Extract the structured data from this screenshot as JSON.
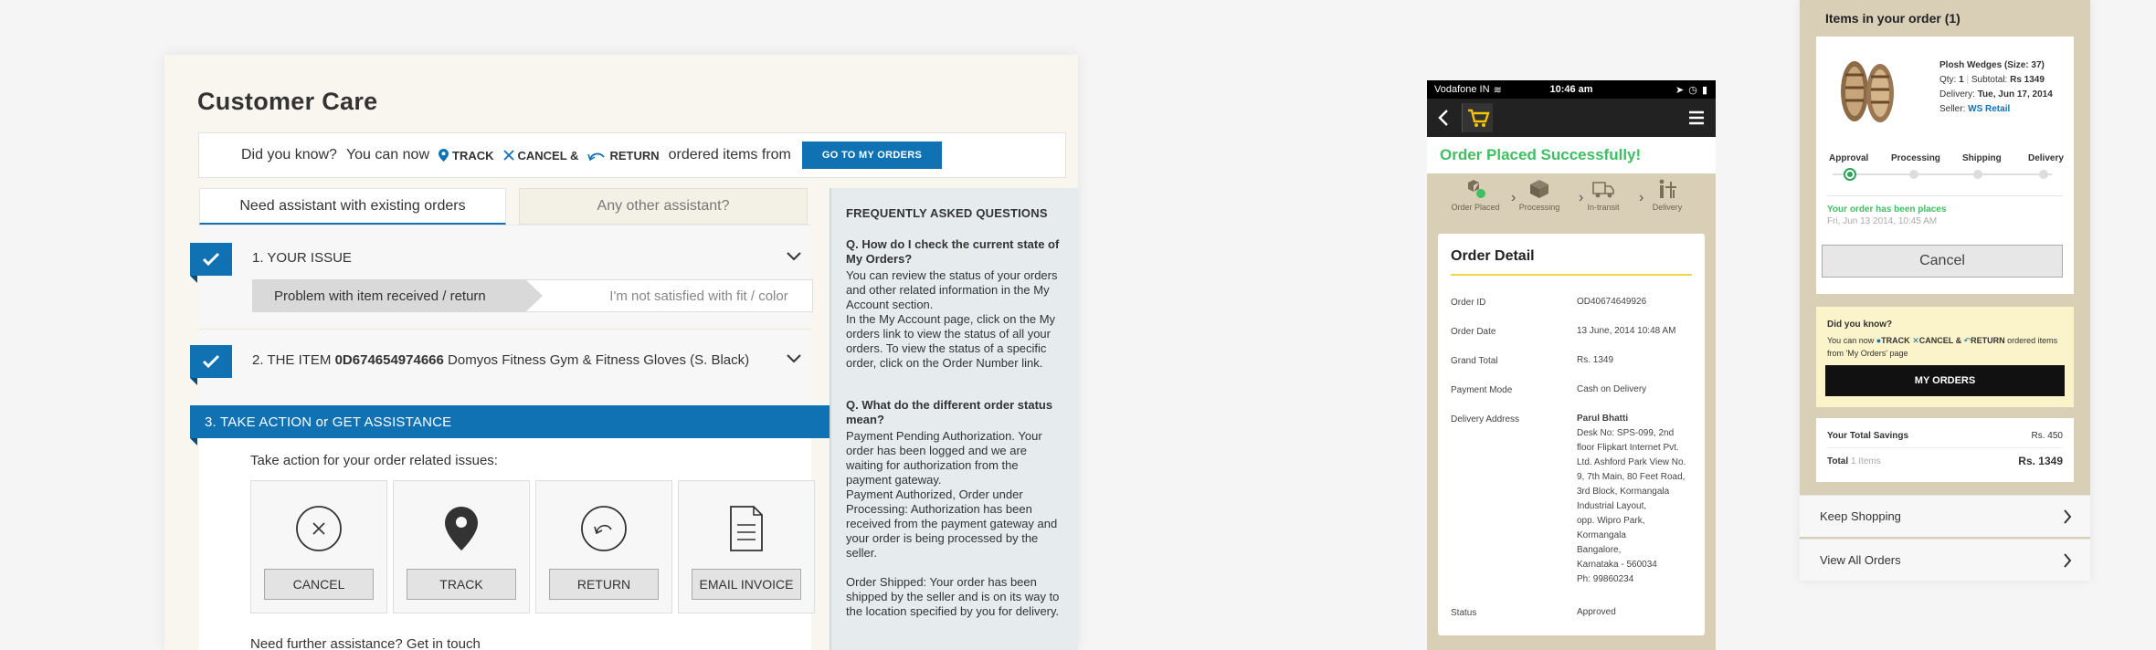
{
  "customer_care": {
    "title": "Customer Care",
    "did_you_know": {
      "label": "Did you know?",
      "text": "You can now",
      "track": "TRACK",
      "cancel": "CANCEL &",
      "return": "RETURN",
      "suffix": "ordered items from",
      "button": "GO TO MY ORDERS"
    },
    "tabs": [
      "Need assistant with existing orders",
      "Any other assistant?"
    ],
    "step1": {
      "title": "1. YOUR ISSUE",
      "selected": "Problem with item received / return",
      "option": "I'm not satisfied with fit / color"
    },
    "step2": {
      "prefix": "2. THE ITEM",
      "item_id": "0D674654974666",
      "item_name": "Domyos Fitness Gym & Fitness Gloves (S. Black)"
    },
    "step3": {
      "title": "3. TAKE ACTION or GET ASSISTANCE",
      "prompt": "Take action for your order related issues:",
      "actions": [
        "CANCEL",
        "TRACK",
        "RETURN",
        "EMAIL INVOICE"
      ],
      "further": "Need further assistance? Get in touch"
    },
    "faq": {
      "heading": "FREQUENTLY ASKED QUESTIONS",
      "items": [
        {
          "q": "Q. How do I check the current state of My Orders?",
          "a": "You can review the status of your orders and other related information in the My Account section.\nIn the My Account page, click on the My orders link to view the status of all your orders. To view the status of a specific order, click on the Order Number link."
        },
        {
          "q": "Q. What do the different order status mean?",
          "a": "Payment Pending Authorization. Your order has been logged and we are waiting for authorization from the payment gateway.\nPayment Authorized, Order under Processing: Authorization has been received from the payment gateway and your order is being processed by the seller.\n\nOrder Shipped: Your order has been shipped by the seller and is on its way to the location specified by you for delivery."
        }
      ]
    }
  },
  "phone": {
    "carrier": "Vodafone IN",
    "time": "10:46 am",
    "success": "Order Placed Successfully!",
    "steps": [
      "Order Placed",
      "Processing",
      "In-transit",
      "Delivery"
    ],
    "detail": {
      "title": "Order Detail",
      "order_id_label": "Order ID",
      "order_id": "OD40674649926",
      "order_date_label": "Order Date",
      "order_date": "13 June, 2014 10:48 AM",
      "grand_total_label": "Grand Total",
      "grand_total": "Rs. 1349",
      "payment_label": "Payment Mode",
      "payment": "Cash on Delivery",
      "address_label": "Delivery Address",
      "address_name": "Parul Bhatti",
      "address_lines": [
        "Desk No: SPS-099, 2nd",
        "floor Flipkart Internet Pvt.",
        "Ltd. Ashford Park View No.",
        "9, 7th Main, 80 Feet Road,",
        "3rd Block, Kormangala",
        "Industrial Layout,",
        "opp. Wipro Park,",
        "Kormangala",
        "Bangalore,",
        "Karnataka - 560034",
        "Ph: 99860234"
      ],
      "status_label": "Status",
      "status": "Approved"
    }
  },
  "right_panel": {
    "heading": "Items in your order (1)",
    "product": {
      "name": "Plosh Wedges (Size: 37)",
      "qty_label": "Qty:",
      "qty": "1",
      "subtotal_label": "Subtotal:",
      "subtotal": "Rs 1349",
      "delivery_label": "Delivery:",
      "delivery": "Tue, Jun 17, 2014",
      "seller_label": "Seller:",
      "seller": "WS Retail"
    },
    "track_steps": [
      "Approval",
      "Processing",
      "Shipping",
      "Delivery"
    ],
    "placed_msg": "Your order has been places",
    "placed_date": "Fri, Jun 13 2014, 10:45 AM",
    "cancel": "Cancel",
    "did_you_know": {
      "title": "Did you know?",
      "pre": "You can now",
      "track": "TRACK",
      "cancel": "CANCEL &",
      "return": "RETURN",
      "post": "ordered items from 'My Orders' page",
      "button": "MY ORDERS"
    },
    "savings_label": "Your Total Savings",
    "savings": "Rs. 450",
    "total_label": "Total",
    "total_items": "1 Items",
    "total": "Rs. 1349",
    "links": [
      "Keep Shopping",
      "View All Orders"
    ]
  },
  "colors": {
    "accent": "#1071b3",
    "success": "#3fbe62",
    "panel_bg": "#d9cfb6"
  }
}
